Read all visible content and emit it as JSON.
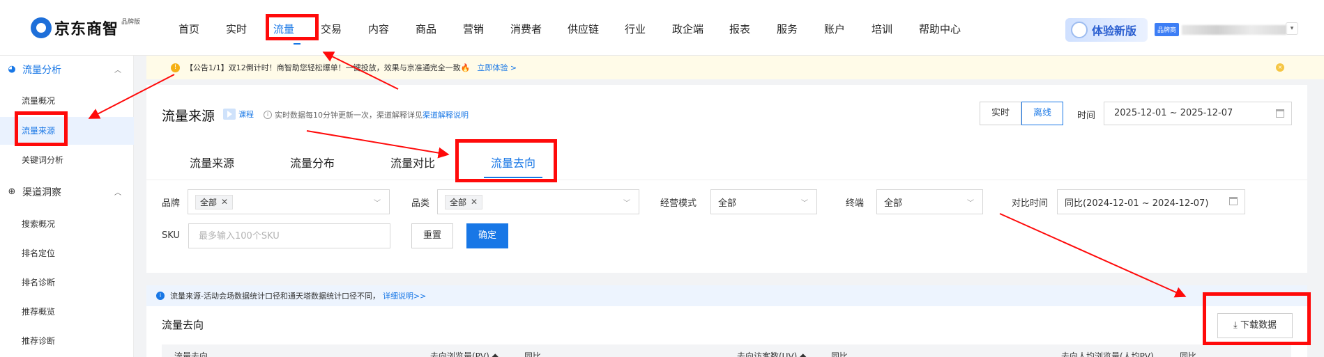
{
  "brand": {
    "name": "京东商智",
    "tag": "品牌版"
  },
  "nav": [
    {
      "label": "首页"
    },
    {
      "label": "实时"
    },
    {
      "label": "流量",
      "active": true
    },
    {
      "label": "交易"
    },
    {
      "label": "内容"
    },
    {
      "label": "商品"
    },
    {
      "label": "营销"
    },
    {
      "label": "消费者"
    },
    {
      "label": "供应链"
    },
    {
      "label": "行业"
    },
    {
      "label": "政企端"
    },
    {
      "label": "报表"
    },
    {
      "label": "服务"
    },
    {
      "label": "账户"
    },
    {
      "label": "培训"
    },
    {
      "label": "帮助中心"
    }
  ],
  "header": {
    "try_new": "体验新版",
    "user_badge": "品牌商",
    "caret": "▾"
  },
  "sidebar": {
    "group1": {
      "label": "流量分析",
      "icon": "pie-chart-icon"
    },
    "items1": [
      "流量概况",
      "流量来源",
      "关键词分析"
    ],
    "group2": {
      "label": "渠道洞察",
      "icon": "compass-icon"
    },
    "items2": [
      "搜索概况",
      "排名定位",
      "排名诊断",
      "推荐概览",
      "推荐诊断"
    ],
    "active_item": "流量来源"
  },
  "notice": {
    "text": "【公告1/1】双12倒计时！商智助您轻松爆单！一键投放，效果与京准通完全一致🔥",
    "link": "立即体验 >"
  },
  "page": {
    "title": "流量来源",
    "course": "课程",
    "info": "实时数据每10分钟更新一次，渠道解释详见",
    "info_link": "渠道解释说明",
    "toggle": [
      "实时",
      "离线"
    ],
    "toggle_active": "离线",
    "time_label": "时间",
    "date_range": "2025-12-01 ~ 2025-12-07"
  },
  "tabs": [
    {
      "label": "流量来源"
    },
    {
      "label": "流量分布"
    },
    {
      "label": "流量对比"
    },
    {
      "label": "流量去向",
      "active": true
    }
  ],
  "filters": {
    "brand_label": "品牌",
    "brand_tag": "全部",
    "category_label": "品类",
    "category_tag": "全部",
    "mode_label": "经营模式",
    "mode_value": "全部",
    "terminal_label": "终端",
    "terminal_value": "全部",
    "compare_label": "对比时间",
    "compare_value": "同比(2024-12-01 ~ 2024-12-07)",
    "sku_label": "SKU",
    "sku_placeholder": "最多输入100个SKU",
    "reset": "重置",
    "confirm": "确定"
  },
  "tip": {
    "text": "流量来源-活动会场数据统计口径和通天塔数据统计口径不同，",
    "link": "详细说明>>"
  },
  "section": {
    "title": "流量去向",
    "download": "下载数据",
    "columns": [
      "流量去向",
      "去向浏览量(PV) ◆",
      "同比",
      "去向访客数(UV) ◆",
      "同比",
      "去向人均浏览量(人均PV)",
      "同比"
    ]
  },
  "colors": {
    "accent": "#1877e6",
    "annotation": "#ff0a0a"
  }
}
